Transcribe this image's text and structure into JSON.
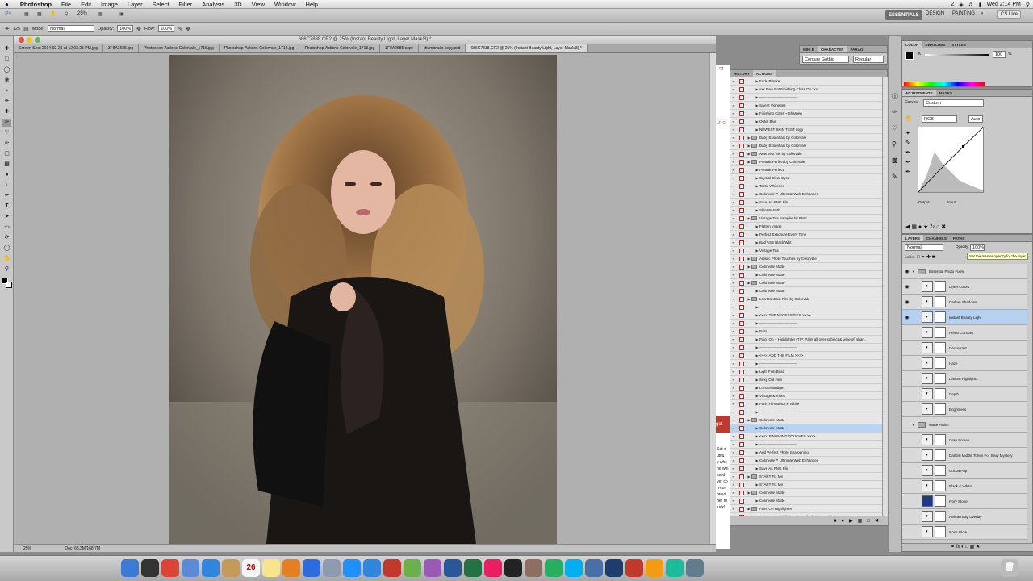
{
  "menubar": {
    "apple": "",
    "app": "Photoshop",
    "items": [
      "File",
      "Edit",
      "Image",
      "Layer",
      "Select",
      "Filter",
      "Analysis",
      "3D",
      "View",
      "Window",
      "Help"
    ],
    "status": {
      "num": "2",
      "clock": "Wed 2:14 PM"
    }
  },
  "appbar": {
    "ps": "Ps",
    "zoom": "25%",
    "workspace": {
      "active": "ESSENTIALS",
      "others": [
        "DESIGN",
        "PAINTING"
      ]
    },
    "cslive": "CS Live"
  },
  "options": {
    "mode_label": "Mode:",
    "mode": "Normal",
    "opacity_label": "Opacity:",
    "opacity": "100%",
    "flow_label": "Flow:",
    "flow": "100%",
    "brush_size": "125"
  },
  "document": {
    "title": "686C7838.CR2 @ 25% (Instant Beauty Light, Layer Mask/8) *",
    "tabs": [
      "Screen Shot 2014-02-26 at 12.03.25 PM.jpg",
      "3F8A2685.jpg",
      "Photoshop-Actions-Colorvale_1716.jpg",
      "Photoshop-Actions-Colorvale_1712.jpg",
      "Photoshop-Actions-Colorvale_1713.jpg",
      "3F8A2685 copy",
      "thumbnails copy.psd",
      "686C7838.CR2 @ 25% (Instant Beauty Light, Layer Mask/8) *"
    ],
    "zoom": "25%",
    "doc_info": "Doc: 63.3M/168.7M"
  },
  "webpage_fragments": [
    "Log",
    "LP C",
    "get",
    "Set o",
    "utifu",
    "y whe",
    "ng whi",
    "lucid",
    "ver co",
    "n cor",
    "orevi",
    "her fri",
    "luck!"
  ],
  "character": {
    "tabs": [
      "MINI B",
      "CHARACTER",
      "PARAG"
    ],
    "font": "Century Gothic",
    "style": "Regular"
  },
  "actions": {
    "tabs": [
      "HISTORY",
      "ACTIONS"
    ],
    "rows": [
      {
        "t": "a",
        "x": "Fade Blanket"
      },
      {
        "t": "a",
        "x": "xxx New Pat Finishing Class On xxx"
      },
      {
        "t": "a",
        "x": "-------------------------------"
      },
      {
        "t": "a",
        "x": "Sweet Vignettes"
      },
      {
        "t": "a",
        "x": "Finishing Class ~ Sharpen"
      },
      {
        "t": "a",
        "x": "Outer Blur"
      },
      {
        "t": "a",
        "x": "NEWEST SKIN TEST copy"
      },
      {
        "t": "f",
        "x": "Baby Essentials by Colorvale"
      },
      {
        "t": "f",
        "x": "Baby Essentials by Colorvale"
      },
      {
        "t": "f",
        "x": "New Test Set by Colorvale"
      },
      {
        "t": "f",
        "x": "Portrait Perfect by Colorvale"
      },
      {
        "t": "a",
        "x": "Portrait Perfect"
      },
      {
        "t": "a",
        "x": "Crystal Clear Eyes"
      },
      {
        "t": "a",
        "x": "Teeth Whitener"
      },
      {
        "t": "a",
        "x": "Colorvale™ Ultimate Web Enhancer"
      },
      {
        "t": "a",
        "x": "Save As PNG File"
      },
      {
        "t": "a",
        "x": "Skin Warmth"
      },
      {
        "t": "f",
        "x": "Vintage Tea Sampler by RME"
      },
      {
        "t": "a",
        "x": "Flatten Image"
      },
      {
        "t": "a",
        "x": "Perfect Exposure Every Time"
      },
      {
        "t": "a",
        "x": "Bad ASS Black/Wht"
      },
      {
        "t": "a",
        "x": "Vintage Tea"
      },
      {
        "t": "f",
        "x": "Artistic Photo Touches by Colorvale"
      },
      {
        "t": "f",
        "x": "Colorvale Matte"
      },
      {
        "t": "a",
        "x": "Colorvale Matte"
      },
      {
        "t": "f",
        "x": "Colorvale Matte"
      },
      {
        "t": "a",
        "x": "Colorvale Matte"
      },
      {
        "t": "f",
        "x": "Low Contrast Film by Colorvale"
      },
      {
        "t": "a",
        "x": "-------------------------------"
      },
      {
        "t": "a",
        "x": "<<<<    THE NECESSITIES    >>>>"
      },
      {
        "t": "a",
        "x": "-------------------------------"
      },
      {
        "t": "a",
        "x": "Balm"
      },
      {
        "t": "a",
        "x": "Paint On ~ Highlighter (TIP:  Paint all over subject & wipe off shar..."
      },
      {
        "t": "a",
        "x": "-------------------------------"
      },
      {
        "t": "a",
        "x": "<<<<    ADD THE FILM    >>>>"
      },
      {
        "t": "a",
        "x": "-------------------------------"
      },
      {
        "t": "a",
        "x": "Light Film Base"
      },
      {
        "t": "a",
        "x": "Sexy Old Film"
      },
      {
        "t": "a",
        "x": "London Bridges"
      },
      {
        "t": "a",
        "x": "Vintage & Vines"
      },
      {
        "t": "a",
        "x": "Paris Film Black & White"
      },
      {
        "t": "a",
        "x": "-------------------------------"
      },
      {
        "t": "f",
        "x": "Colorvale Matte"
      },
      {
        "t": "a",
        "x": "Colorvale Matte",
        "sel": true
      },
      {
        "t": "a",
        "x": "<<<<    FINISHING TOUCHES    >>>>"
      },
      {
        "t": "a",
        "x": "-------------------------------"
      },
      {
        "t": "a",
        "x": "Add Perfect Photo Sharpening"
      },
      {
        "t": "a",
        "x": "Colorvale™ Ultimate Web Enhancer"
      },
      {
        "t": "a",
        "x": "Save As PNG File"
      },
      {
        "t": "f",
        "x": "START Fix Me"
      },
      {
        "t": "a",
        "x": "START Fix Me"
      },
      {
        "t": "f",
        "x": "Colorvale Matte"
      },
      {
        "t": "a",
        "x": "Colorvale Matte"
      },
      {
        "t": "f",
        "x": "Paint On Highlighter"
      },
      {
        "t": "a",
        "x": "Paint On ~ Highlighter (great for hair, eyes, lips)"
      }
    ]
  },
  "color": {
    "tabs": [
      "COLOR",
      "SWATCHES",
      "STYLES"
    ],
    "k_label": "K",
    "k_value": "100",
    "unit": "%"
  },
  "adjustments": {
    "tabs": [
      "ADJUSTMENTS",
      "MASKS"
    ],
    "curves_label": "Curves",
    "preset": "Custom",
    "channel": "RGB",
    "auto": "Auto",
    "output": "Output:",
    "input": "Input:"
  },
  "layers": {
    "tabs": [
      "LAYERS",
      "CHANNELS",
      "PATHS"
    ],
    "blend": "Normal",
    "opacity_label": "Opacity:",
    "opacity": "100%",
    "lock_label": "Lock:",
    "fill_label": "Fill:",
    "tooltip": "Set the master opacity for the layer",
    "rows": [
      {
        "name": "Essential Photo Fixes",
        "kind": "group"
      },
      {
        "name": "Linen Colors",
        "kind": "adj"
      },
      {
        "name": "Darken Shadows",
        "kind": "adj"
      },
      {
        "name": "Instant Beauty Light",
        "kind": "adj",
        "sel": true
      },
      {
        "name": "Remo Contrast",
        "kind": "adj"
      },
      {
        "name": "Decontrast",
        "kind": "adj"
      },
      {
        "name": "Haze",
        "kind": "adj"
      },
      {
        "name": "Darken Highlights",
        "kind": "adj"
      },
      {
        "name": "Depth",
        "kind": "adj"
      },
      {
        "name": "Brightness",
        "kind": "adj"
      },
      {
        "name": "Matte Finish",
        "kind": "group"
      },
      {
        "name": "Gray Screen",
        "kind": "adj"
      },
      {
        "name": "Darken Middle Tones For Sexy Mystery",
        "kind": "adj"
      },
      {
        "name": "Cocoa Pop",
        "kind": "adj"
      },
      {
        "name": "Black & White",
        "kind": "adj"
      },
      {
        "name": "Ivory Stone",
        "kind": "fill"
      },
      {
        "name": "Pelican Bay Overlay",
        "kind": "adj"
      },
      {
        "name": "Rose Glow",
        "kind": "adj"
      }
    ]
  },
  "dock": {
    "apps": [
      "Finder",
      "Dashboard",
      "Chrome",
      "Mail",
      "Safari",
      "Contacts",
      "Calendar",
      "Notes",
      "Illustrator",
      "Photoshop",
      "Preview",
      "QuickTime",
      "App Store",
      "Acrobat",
      "iPhoto",
      "iTunes",
      "Word",
      "Excel",
      "InDesign",
      "Terminal",
      "Bridge",
      "iChat",
      "Skype",
      "Lightroom",
      "Photoshop CS5",
      "FileZilla",
      "Pinwheel",
      "Aqua",
      "Security"
    ],
    "calendar_date": "26"
  },
  "colors": {
    "selection": "#b9d3f0",
    "layer_selection": "#b6d0f0",
    "accent": "#3b6fb6"
  }
}
